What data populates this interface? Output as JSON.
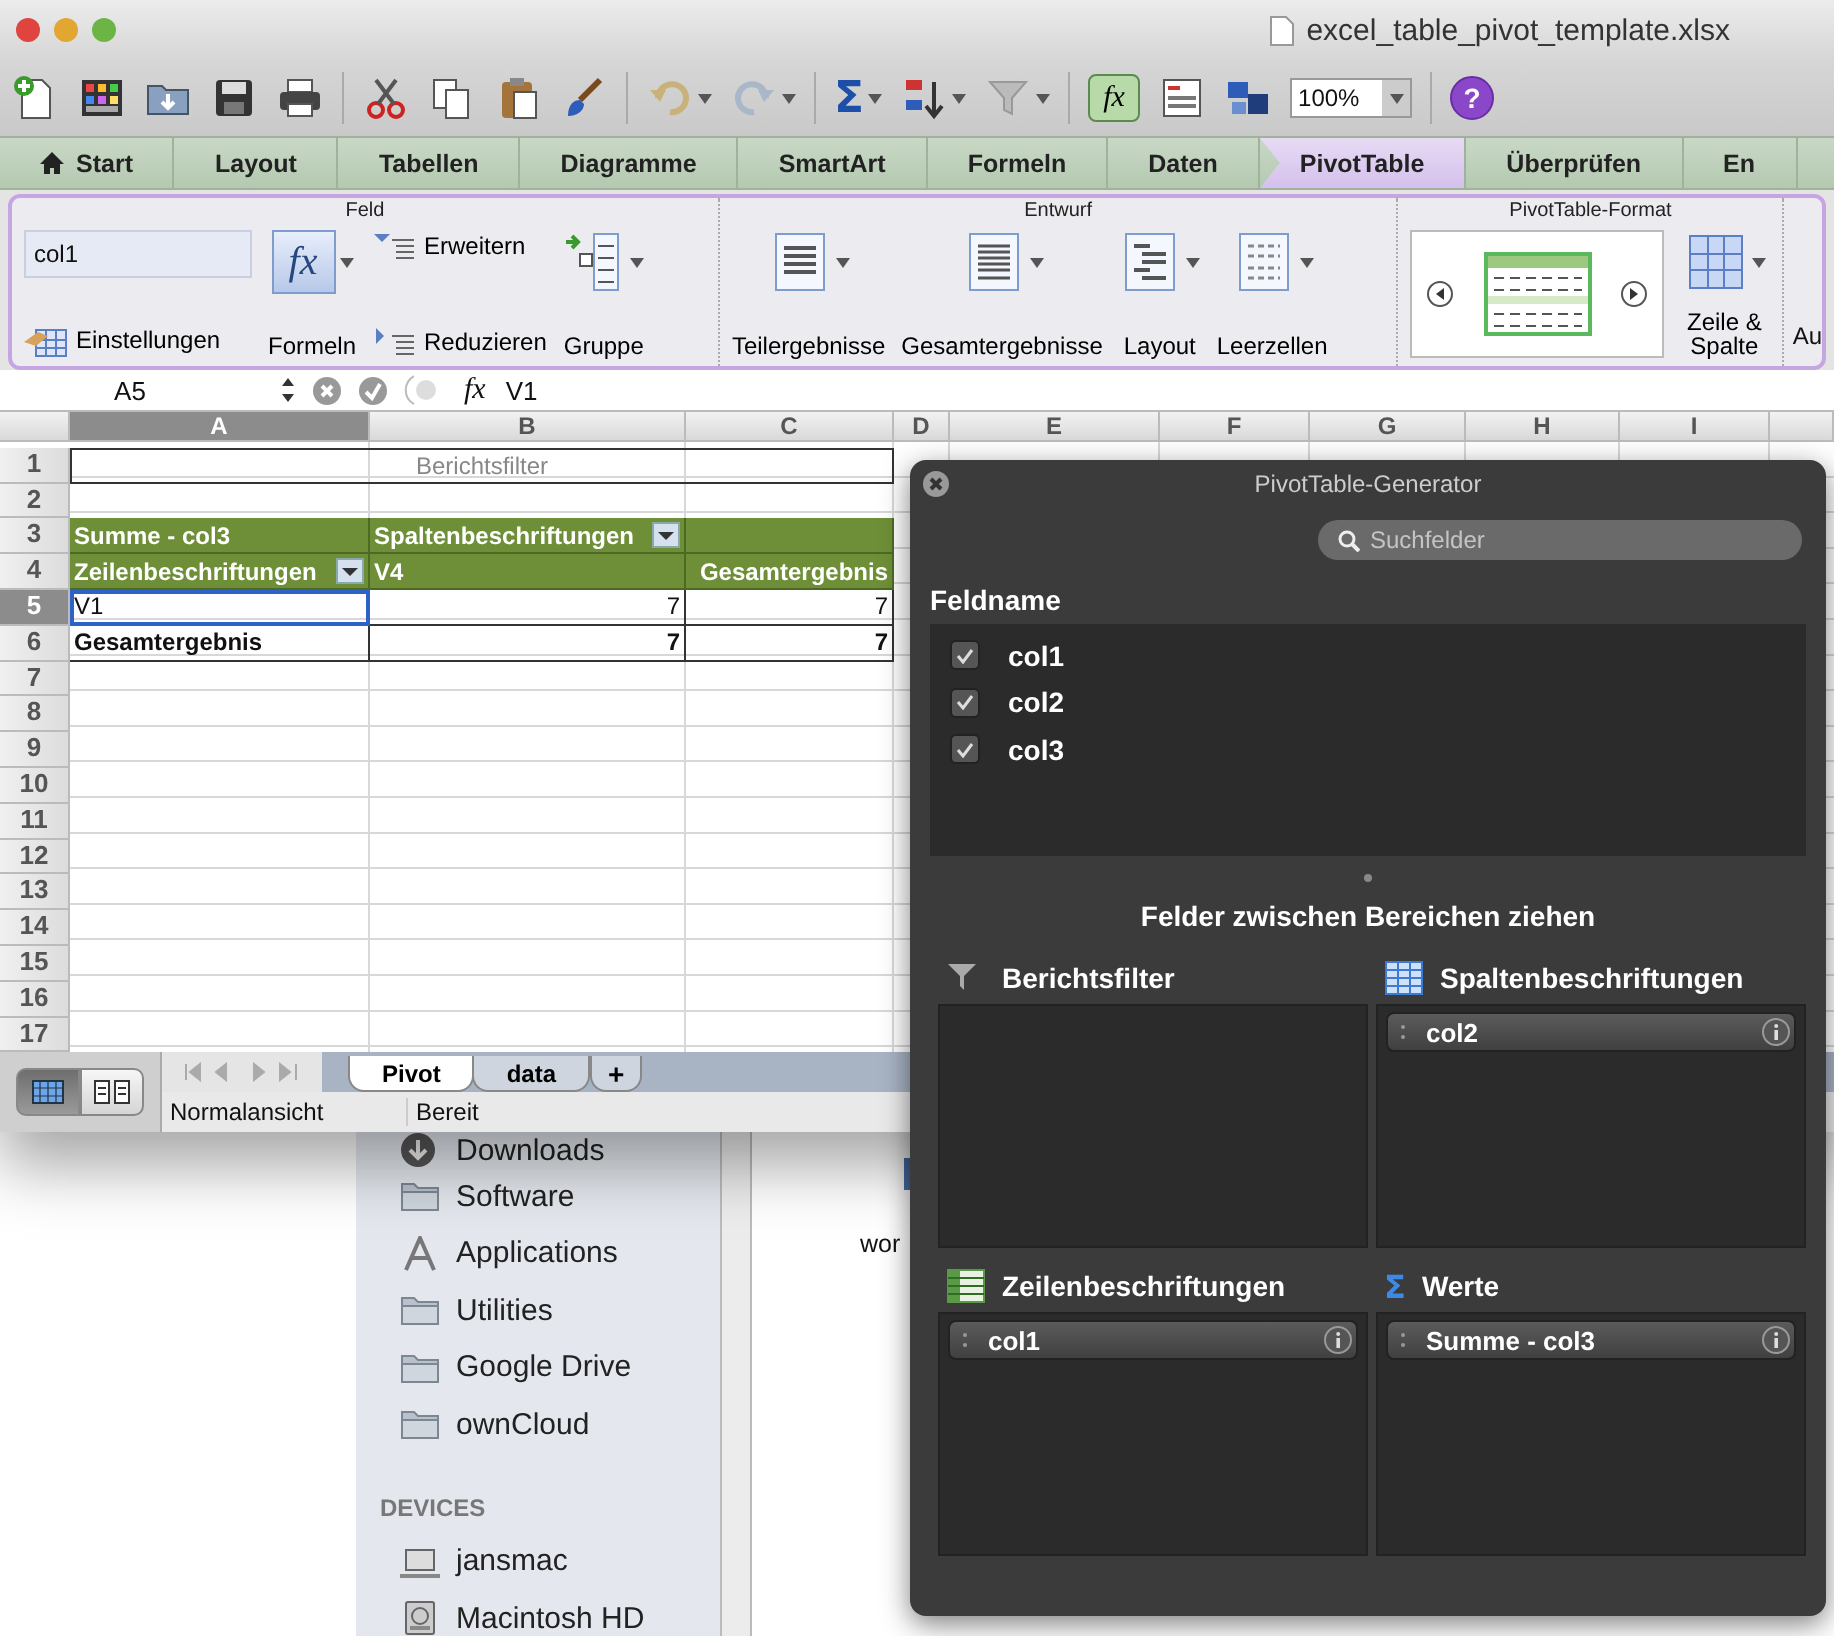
{
  "title_bar": {
    "title": "excel_table_pivot_template.xlsx"
  },
  "toolbar": {
    "sum_symbol": "Σ",
    "formula_symbol": "fx",
    "zoom": "100%",
    "help_symbol": "?"
  },
  "ribbon": {
    "tabs": [
      {
        "label": "Start",
        "kind": "home",
        "selected": false
      },
      {
        "label": "Layout",
        "kind": "plain",
        "selected": false
      },
      {
        "label": "Tabellen",
        "kind": "plain",
        "selected": false
      },
      {
        "label": "Diagramme",
        "kind": "plain",
        "selected": false
      },
      {
        "label": "SmartArt",
        "kind": "plain",
        "selected": false
      },
      {
        "label": "Formeln",
        "kind": "plain",
        "selected": false
      },
      {
        "label": "Daten",
        "kind": "plain",
        "selected": false
      },
      {
        "label": "PivotTable",
        "kind": "plain",
        "selected": true
      },
      {
        "label": "Überprüfen",
        "kind": "plain",
        "selected": false
      },
      {
        "label": "En",
        "kind": "plain",
        "selected": false
      }
    ],
    "groups": [
      {
        "title": "Feld",
        "items": [
          {
            "kind": "stack",
            "items": [
              {
                "kind": "field",
                "value": "col1"
              },
              {
                "kind": "small",
                "label": "Einstellungen"
              }
            ]
          },
          {
            "kind": "large",
            "icon_text": "fx",
            "label": "Formeln",
            "menu": true
          },
          {
            "kind": "stack",
            "items": [
              {
                "kind": "small",
                "label": "Erweitern"
              },
              {
                "kind": "small",
                "label": "Reduzieren"
              }
            ]
          },
          {
            "kind": "large",
            "label": "Gruppe",
            "menu": true
          }
        ]
      },
      {
        "title": "Entwurf",
        "items": [
          {
            "kind": "large",
            "label": "Teilergebnisse",
            "menu": true
          },
          {
            "kind": "large",
            "label": "Gesamtergebnisse",
            "menu": true
          },
          {
            "kind": "large",
            "label": "Layout",
            "menu": true
          },
          {
            "kind": "large",
            "label": "Leerzellen",
            "menu": true
          }
        ]
      },
      {
        "title": "PivotTable-Format",
        "items": [
          {
            "kind": "gallery"
          },
          {
            "kind": "large",
            "label": "Zeile & Spalte",
            "menu": true
          }
        ]
      }
    ],
    "overflow_label": "Au"
  },
  "formula_bar": {
    "cell_ref": "A5",
    "formula_symbol": "fx",
    "value": "V1"
  },
  "sheet": {
    "columns": [
      "A",
      "B",
      "C",
      "D",
      "E",
      "F",
      "G",
      "H",
      "I"
    ],
    "rows": [
      {
        "number": "1",
        "cells": [
          {
            "kind": "filter",
            "text": "Berichtsfilter",
            "selected": false,
            "dropdown": false,
            "right_aligned": false
          }
        ]
      },
      {
        "number": "2"
      },
      {
        "number": "3",
        "cells": [
          {
            "kind": "header",
            "text": "Summe - col3",
            "selected": false,
            "dropdown": false,
            "right_aligned": false
          },
          {
            "kind": "header",
            "text": "Spaltenbeschriftungen",
            "dropdown": true,
            "selected": false,
            "right_aligned": false
          },
          {
            "kind": "header",
            "selected": false,
            "dropdown": false
          }
        ]
      },
      {
        "number": "4",
        "cells": [
          {
            "kind": "header",
            "text": "Zeilenbeschriftungen",
            "dropdown": true,
            "selected": false,
            "right_aligned": false
          },
          {
            "kind": "header",
            "text": "V4",
            "selected": false,
            "dropdown": false,
            "right_aligned": false
          },
          {
            "kind": "header",
            "text": "Gesamtergebnis",
            "right_aligned": true,
            "selected": false,
            "dropdown": false
          }
        ]
      },
      {
        "number": "5",
        "cells": [
          {
            "kind": "value",
            "text": "V1",
            "selected": true,
            "dropdown": false,
            "right_aligned": false
          },
          {
            "kind": "value",
            "text": "7",
            "right_aligned": true,
            "selected": false,
            "dropdown": false
          },
          {
            "kind": "value",
            "text": "7",
            "right_aligned": true,
            "selected": false,
            "dropdown": false
          }
        ]
      },
      {
        "number": "6",
        "cells": [
          {
            "kind": "total",
            "text": "Gesamtergebnis",
            "selected": false,
            "dropdown": false,
            "right_aligned": false
          },
          {
            "kind": "total",
            "text": "7",
            "right_aligned": true,
            "selected": false,
            "dropdown": false
          },
          {
            "kind": "total",
            "text": "7",
            "right_aligned": true,
            "selected": false,
            "dropdown": false
          }
        ]
      },
      {
        "number": "7"
      },
      {
        "number": "8"
      },
      {
        "number": "9"
      },
      {
        "number": "10"
      },
      {
        "number": "11"
      },
      {
        "number": "12"
      },
      {
        "number": "13"
      },
      {
        "number": "14"
      },
      {
        "number": "15"
      },
      {
        "number": "16"
      },
      {
        "number": "17"
      }
    ]
  },
  "sheet_tabs": [
    {
      "label": "Pivot",
      "selected": true
    },
    {
      "label": "data",
      "selected": false
    }
  ],
  "add_sheet": "+",
  "views": [
    {
      "kind": "normal",
      "selected": true
    },
    {
      "kind": "layout",
      "selected": false
    }
  ],
  "status_bar": {
    "view": "Normalansicht",
    "state": "Bereit"
  },
  "finder": {
    "items": [
      {
        "kind": "download",
        "label": "Downloads"
      },
      {
        "kind": "folder",
        "label": "Software"
      },
      {
        "kind": "apps",
        "label": "Applications"
      },
      {
        "kind": "folder",
        "label": "Utilities"
      },
      {
        "kind": "folder",
        "label": "Google Drive"
      },
      {
        "kind": "folder",
        "label": "ownCloud"
      },
      {
        "kind": "section",
        "label": "DEVICES"
      },
      {
        "kind": "laptop",
        "label": "jansmac"
      },
      {
        "kind": "disk",
        "label": "Macintosh HD"
      }
    ],
    "content_text": "wor"
  },
  "pivot_panel": {
    "title": "PivotTable-Generator",
    "search_placeholder": "Suchfelder",
    "fields_label": "Feldname",
    "fields": [
      {
        "name": "col1",
        "checked": true
      },
      {
        "name": "col2",
        "checked": true
      },
      {
        "name": "col3",
        "checked": true
      }
    ],
    "areas_hint": "Felder zwischen Bereichen ziehen",
    "areas": [
      {
        "kind": "filter",
        "title": "Berichtsfilter"
      },
      {
        "kind": "columns",
        "title": "Spaltenbeschriftungen",
        "items": [
          "col2"
        ]
      },
      {
        "kind": "rows",
        "title": "Zeilenbeschriftungen",
        "items": [
          "col1"
        ]
      },
      {
        "kind": "values",
        "symbol": "Σ",
        "title": "Werte",
        "items": [
          "Summe - col3"
        ]
      }
    ]
  }
}
